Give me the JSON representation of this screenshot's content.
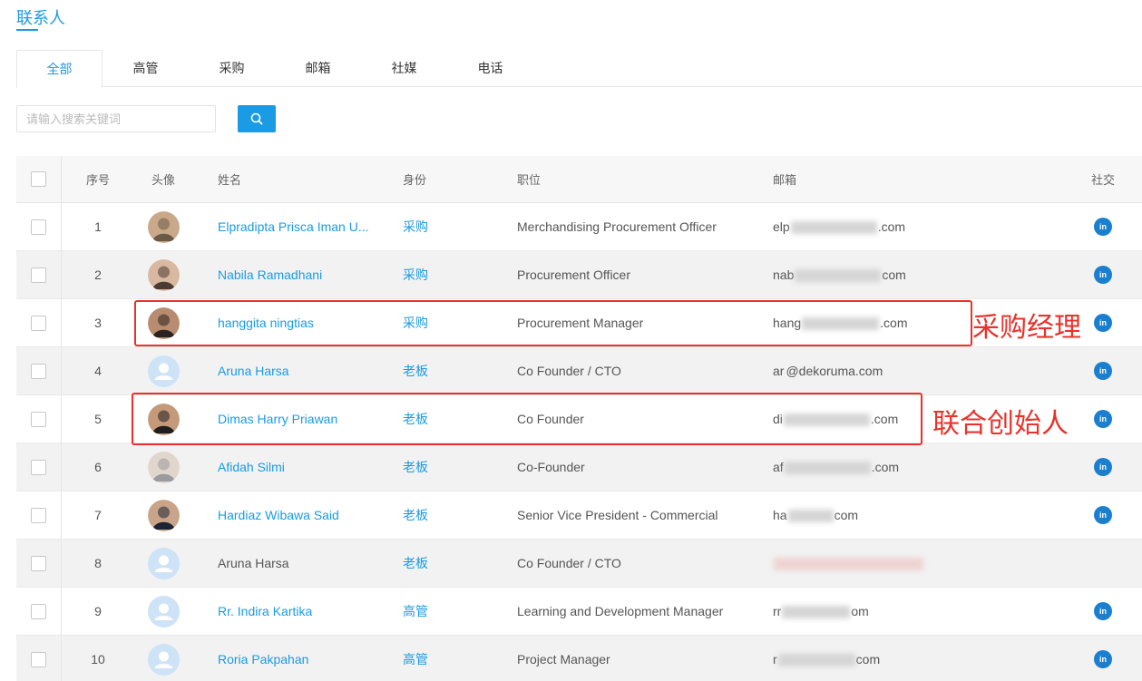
{
  "page": {
    "title": "联系人"
  },
  "tabs": [
    {
      "label": "全部",
      "active": true
    },
    {
      "label": "高管"
    },
    {
      "label": "采购"
    },
    {
      "label": "邮箱"
    },
    {
      "label": "社媒"
    },
    {
      "label": "电话"
    }
  ],
  "search": {
    "placeholder": "请输入搜索关键词",
    "value": ""
  },
  "table": {
    "headers": {
      "no": "序号",
      "avatar": "头像",
      "name": "姓名",
      "role": "身份",
      "title": "职位",
      "email": "邮箱",
      "social": "社交"
    },
    "rows": [
      {
        "no": "1",
        "name": "Elpradipta Prisca Iman U...",
        "role": "采购",
        "title": "Merchandising Procurement Officer",
        "email_start": "elp",
        "email_end": ".com",
        "avatar": "photo",
        "linkedin": "in"
      },
      {
        "no": "2",
        "name": "Nabila Ramadhani",
        "role": "采购",
        "title": "Procurement Officer",
        "email_start": "nab",
        "email_end": "com",
        "avatar": "photo",
        "linkedin": "in"
      },
      {
        "no": "3",
        "name": "hanggita ningtias",
        "role": "采购",
        "title": "Procurement Manager",
        "email_start": "hang",
        "email_end": ".com",
        "avatar": "photo",
        "linkedin": "in"
      },
      {
        "no": "4",
        "name": "Aruna Harsa",
        "role": "老板",
        "title": "Co Founder / CTO",
        "email_start": "ar",
        "email_end": "@dekoruma.com",
        "avatar": "default",
        "linkedin": "in"
      },
      {
        "no": "5",
        "name": "Dimas Harry Priawan",
        "role": "老板",
        "title": "Co Founder",
        "email_start": "di",
        "email_end": ".com",
        "avatar": "photo",
        "linkedin": "in"
      },
      {
        "no": "6",
        "name": "Afidah Silmi",
        "role": "老板",
        "title": "Co-Founder",
        "email_start": "af",
        "email_end": ".com",
        "avatar": "photo",
        "linkedin": "in"
      },
      {
        "no": "7",
        "name": "Hardiaz Wibawa Said",
        "role": "老板",
        "title": "Senior Vice President - Commercial",
        "email_start": "ha",
        "email_end": "com",
        "avatar": "photo",
        "linkedin": "in"
      },
      {
        "no": "8",
        "name": "Aruna Harsa",
        "role": "老板",
        "title": "Co Founder / CTO",
        "email_start": "",
        "email_end": "",
        "avatar": "default",
        "linkedin": ""
      },
      {
        "no": "9",
        "name": "Rr. Indira Kartika",
        "role": "高管",
        "title": "Learning and Development Manager",
        "email_start": "rr",
        "email_end": "om",
        "avatar": "default",
        "linkedin": "in"
      },
      {
        "no": "10",
        "name": "Roria Pakpahan",
        "role": "高管",
        "title": "Project Manager",
        "email_start": "r",
        "email_end": "com",
        "avatar": "default",
        "linkedin": "in"
      }
    ]
  },
  "annotations": [
    {
      "text": "采购经理"
    },
    {
      "text": "联合创始人"
    }
  ],
  "colors": {
    "accent": "#1a9be3",
    "annotation": "#e8322b",
    "linkedin": "#1a7fce"
  }
}
